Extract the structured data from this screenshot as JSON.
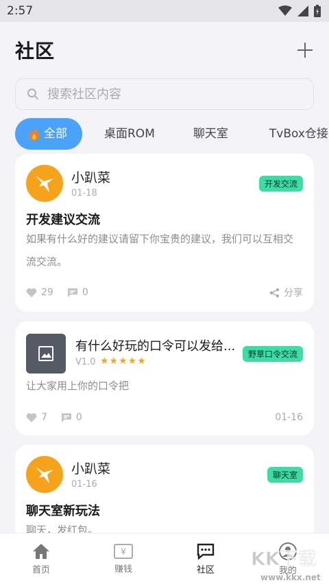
{
  "status_bar": {
    "time": "2:57"
  },
  "header": {
    "title": "社区"
  },
  "search": {
    "placeholder": "搜索社区内容"
  },
  "tabs": [
    {
      "label": "全部",
      "icon": "fire-icon",
      "active": true
    },
    {
      "label": "桌面ROM"
    },
    {
      "label": "聊天室"
    },
    {
      "label": "TvBox仓接口"
    }
  ],
  "posts": [
    {
      "username": "小趴菜",
      "date": "01-18",
      "badge": "开发交流",
      "title": "开发建议交流",
      "body": "如果有什么好的建议请留下你宝贵的建议，我们可以互相交流交流。",
      "likes": "29",
      "comments": "0",
      "share_label": "分享"
    },
    {
      "title": "有什么好玩的口令可以发给...",
      "version": "V1.0",
      "stars": "★★★★★",
      "badge": "野草口令交流",
      "body": "让大家用上你的口令把",
      "likes": "7",
      "comments": "0",
      "date": "01-16"
    },
    {
      "username": "小趴菜",
      "date": "01-16",
      "badge": "聊天室",
      "title": "聊天室新玩法",
      "body": "聊天，发红包。"
    }
  ],
  "bottom_nav": [
    {
      "label": "首页",
      "icon": "home-icon"
    },
    {
      "label": "赚钱",
      "icon": "money-icon"
    },
    {
      "label": "社区",
      "icon": "community-icon",
      "active": true
    },
    {
      "label": "我的",
      "icon": "profile-icon"
    }
  ],
  "watermark": {
    "text": "KK下载",
    "url_text": "www.kkx.net"
  },
  "colors": {
    "accent": "#4aa3f8",
    "badge": "#3ddba5",
    "avatar": "#f7a21b",
    "star": "#f5a623"
  }
}
